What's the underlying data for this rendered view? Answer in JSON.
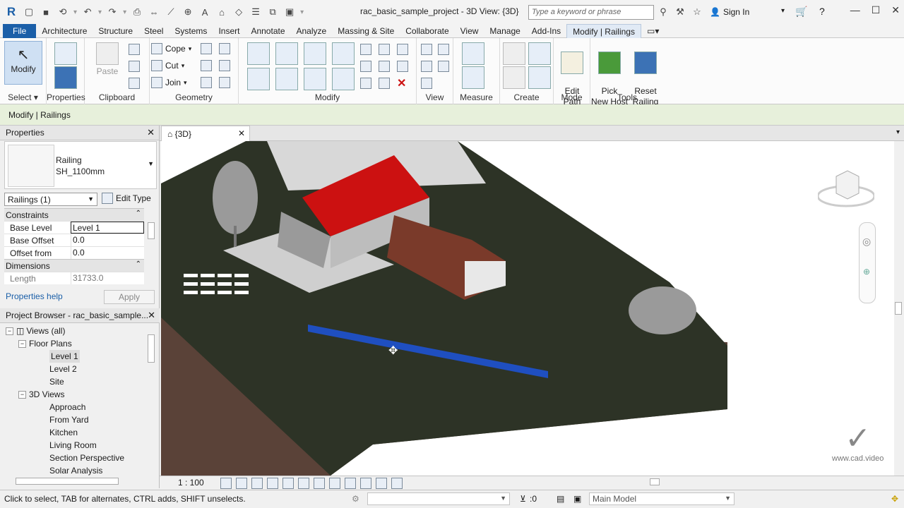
{
  "app": {
    "title": "rac_basic_sample_project - 3D View: {3D}",
    "search_placeholder": "Type a keyword or phrase",
    "sign_in": "Sign In",
    "logo": "R"
  },
  "menu": {
    "tabs": [
      "File",
      "Architecture",
      "Structure",
      "Steel",
      "Systems",
      "Insert",
      "Annotate",
      "Analyze",
      "Massing & Site",
      "Collaborate",
      "View",
      "Manage",
      "Add-Ins",
      "Modify | Railings"
    ],
    "active": "Modify | Railings"
  },
  "ribbon": {
    "modify_label": "Modify",
    "properties_label": "Properties",
    "paste_label": "Paste",
    "cope_label": "Cope",
    "cut_label": "Cut",
    "join_label": "Join",
    "edit_path_label": "Edit\nPath",
    "pick_new_host_label": "Pick\nNew Host",
    "reset_railing_label": "Reset\nRailing",
    "panels": [
      "Select",
      "Properties",
      "Clipboard",
      "Geometry",
      "Modify",
      "View",
      "Measure",
      "Create",
      "Mode",
      "Tools"
    ]
  },
  "context_bar": "Modify | Railings",
  "properties": {
    "title": "Properties",
    "type_family": "Railing",
    "type_name": "SH_1100mm",
    "instance_selector": "Railings (1)",
    "edit_type": "Edit Type",
    "sections": {
      "constraints": "Constraints",
      "dimensions": "Dimensions"
    },
    "rows": [
      {
        "key": "Base Level",
        "value": "Level 1"
      },
      {
        "key": "Base Offset",
        "value": "0.0"
      },
      {
        "key": "Offset from P...",
        "value": "0.0"
      }
    ],
    "length_key": "Length",
    "length_value": "31733.0",
    "help": "Properties help",
    "apply": "Apply"
  },
  "project_browser": {
    "title": "Project Browser - rac_basic_sample...",
    "views_all": "Views (all)",
    "floor_plans": "Floor Plans",
    "floor_items": [
      "Level 1",
      "Level 2",
      "Site"
    ],
    "views_3d": "3D Views",
    "views_3d_items": [
      "Approach",
      "From Yard",
      "Kitchen",
      "Living Room",
      "Section Perspective",
      "Solar Analysis"
    ]
  },
  "view": {
    "tab_label": "{3D}",
    "scale": "1 : 100",
    "watermark": "www.cad.video"
  },
  "status": {
    "message": "Click to select, TAB for alternates, CTRL adds, SHIFT unselects.",
    "filter_count": ":0",
    "model": "Main Model"
  },
  "colors": {
    "roof": "#cc1111",
    "selected_railing": "#1f4fc0",
    "terrain_top": "#2d3326",
    "terrain_side": "#5a4238"
  }
}
